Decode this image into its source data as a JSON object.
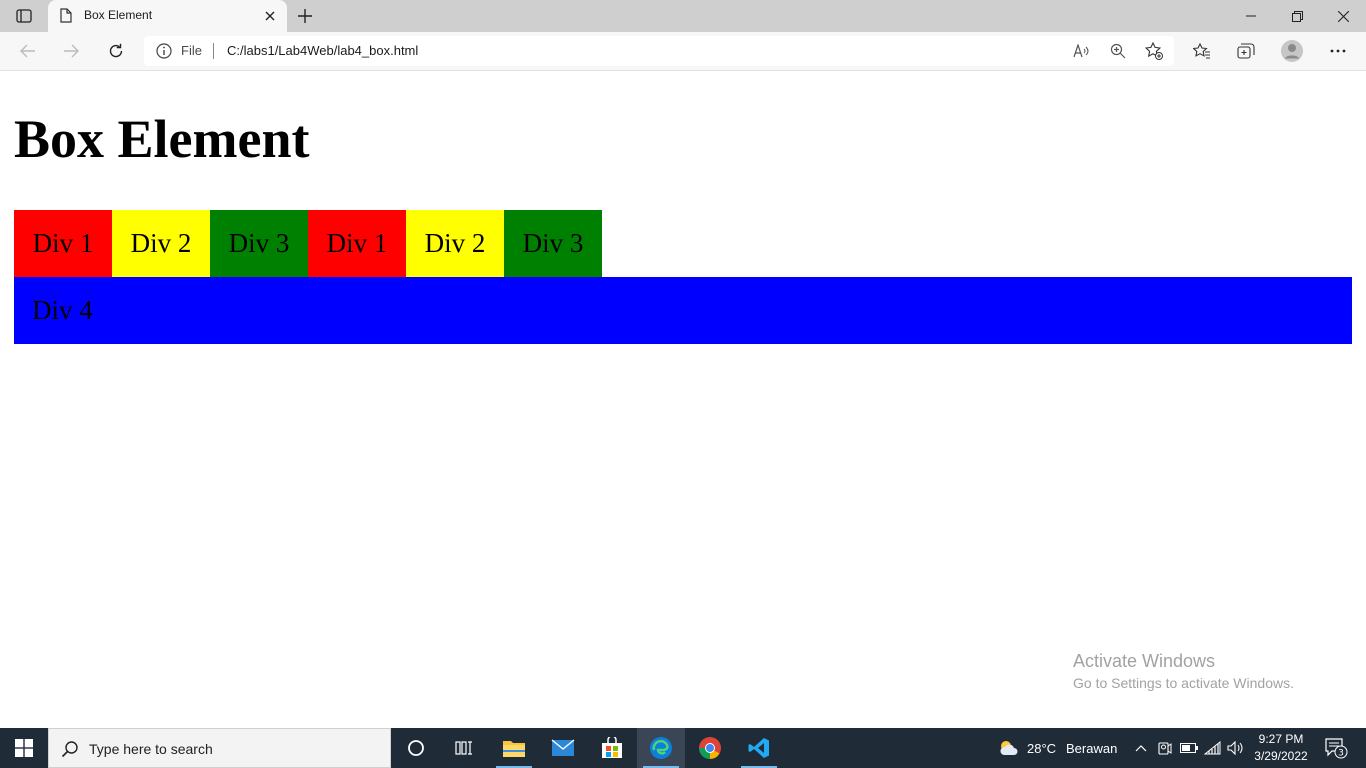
{
  "browser": {
    "tab_title": "Box Element",
    "address_scheme_label": "File",
    "url": "C:/labs1/Lab4Web/lab4_box.html"
  },
  "page": {
    "heading": "Box Element",
    "boxes": [
      {
        "label": "Div 1",
        "color": "#ff0000"
      },
      {
        "label": "Div 2",
        "color": "#ffff00"
      },
      {
        "label": "Div 3",
        "color": "#008000"
      },
      {
        "label": "Div 1",
        "color": "#ff0000"
      },
      {
        "label": "Div 2",
        "color": "#ffff00"
      },
      {
        "label": "Div 3",
        "color": "#008000"
      }
    ],
    "wide_box": {
      "label": "Div 4",
      "color": "#0000ff"
    }
  },
  "watermark": {
    "title": "Activate Windows",
    "subtitle": "Go to Settings to activate Windows."
  },
  "taskbar": {
    "search_placeholder": "Type here to search",
    "weather_temp": "28°C",
    "weather_desc": "Berawan",
    "time": "9:27 PM",
    "date": "3/29/2022",
    "notification_count": "3"
  }
}
